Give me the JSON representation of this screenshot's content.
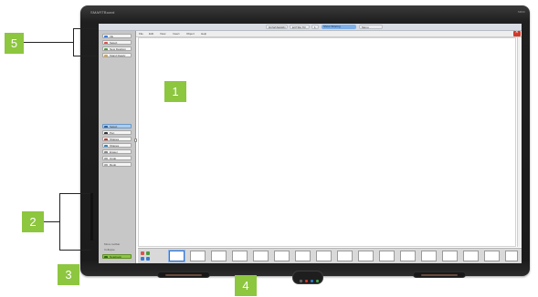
{
  "board": {
    "brand": "SMARTBoard",
    "model": "M600"
  },
  "topbar": {
    "items": [
      "DOWNWARD",
      "EXTRA TR",
      "1",
      "Show Sharing",
      "Menu"
    ]
  },
  "menubar": {
    "items": [
      "File",
      "Edit",
      "View",
      "Insert",
      "Object",
      "Help"
    ]
  },
  "sidebar": {
    "top_buttons": [
      "Ink",
      "Select",
      "New Desktop",
      "Stand Ready"
    ],
    "tool_buttons": [
      "Select",
      "Pen",
      "Shapes",
      "Shapes",
      "Eraser",
      "Undo",
      "Redo"
    ],
    "notes": [
      "Move toolbar",
      "Collapse"
    ],
    "action_button": "Notebook"
  },
  "callouts": {
    "c1": "1",
    "c2": "2",
    "c3": "3",
    "c4": "4",
    "c5": "5"
  },
  "colors": {
    "callout": "#8dc63f",
    "bezel": "#1d1d1d",
    "sidebar": "#c7c7c7",
    "close": "#d23a2a",
    "pen_colors": [
      "#2b2b2b",
      "#d93a2a",
      "#2a7fd9",
      "#3bb34a"
    ]
  }
}
